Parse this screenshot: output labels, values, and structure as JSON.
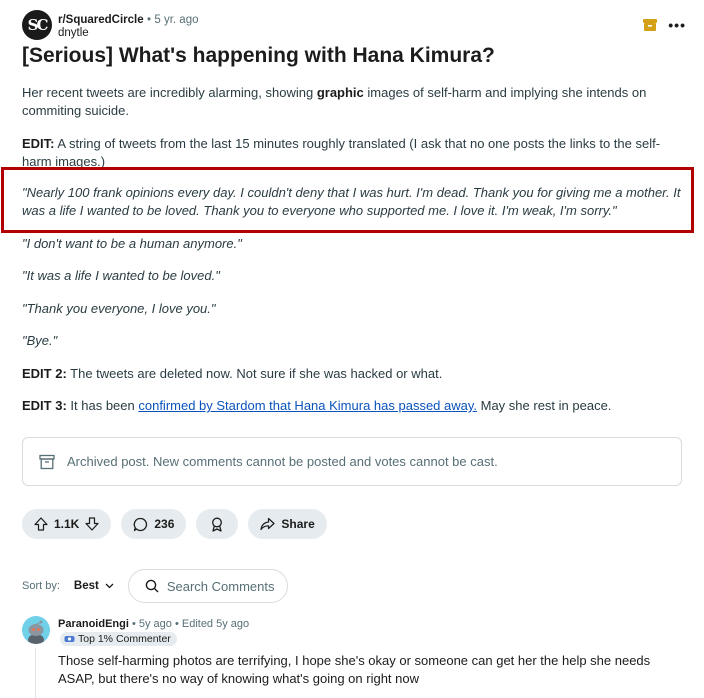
{
  "post": {
    "subreddit": "r/SquaredCircle",
    "subreddit_logo_text": "SC",
    "separator": "•",
    "age": "5 yr. ago",
    "author": "dnytle",
    "title": "[Serious] What's happening with Hana Kimura?",
    "para1_pre": "Her recent tweets are incredibly alarming, showing ",
    "para1_bold": "graphic",
    "para1_post": " images of self-harm and implying she intends on commiting suicide.",
    "edit1_label": "EDIT:",
    "edit1_text": " A string of tweets from the last 15 minutes roughly translated (I ask that no one posts the links to the self-harm images.)",
    "quote1": "\"Nearly 100 frank opinions every day. I couldn't deny that I was hurt. I'm dead. Thank you for giving me a mother. It was a life I wanted to be loved. Thank you to everyone who supported me. I love it. I'm weak, I'm sorry.\"",
    "quote2": "\"I don't want to be a human anymore.\"",
    "quote3": "\"It was a life I wanted to be loved.\"",
    "quote4": "\"Thank you everyone, I love you.\"",
    "quote5": "\"Bye.\"",
    "edit2_label": "EDIT 2:",
    "edit2_text": " The tweets are deleted now. Not sure if she was hacked or what.",
    "edit3_label": "EDIT 3:",
    "edit3_pre": " It has been ",
    "edit3_link": "confirmed by Stardom that Hana Kimura has passed away.",
    "edit3_post": " May she rest in peace.",
    "archived_notice": "Archived post. New comments cannot be posted and votes cannot be cast."
  },
  "actions": {
    "votes": "1.1K",
    "comments": "236",
    "share": "Share"
  },
  "sort": {
    "label": "Sort by:",
    "value": "Best",
    "search_placeholder": "Search Comments"
  },
  "comment": {
    "username": "ParanoidEngi",
    "meta": " • 5y ago • Edited 5y ago",
    "flair": "Top 1% Commenter",
    "text": "Those self-harming photos are terrifying, I hope she's okay or someone can get her the help she needs ASAP, but there's no way of knowing what's going on right now"
  },
  "colors": {
    "highlight_border": "#b00000",
    "link": "#0a53be",
    "pill_bg": "#e5ebee",
    "muted_text": "#576f76",
    "archive_icon": "#d4a017"
  }
}
